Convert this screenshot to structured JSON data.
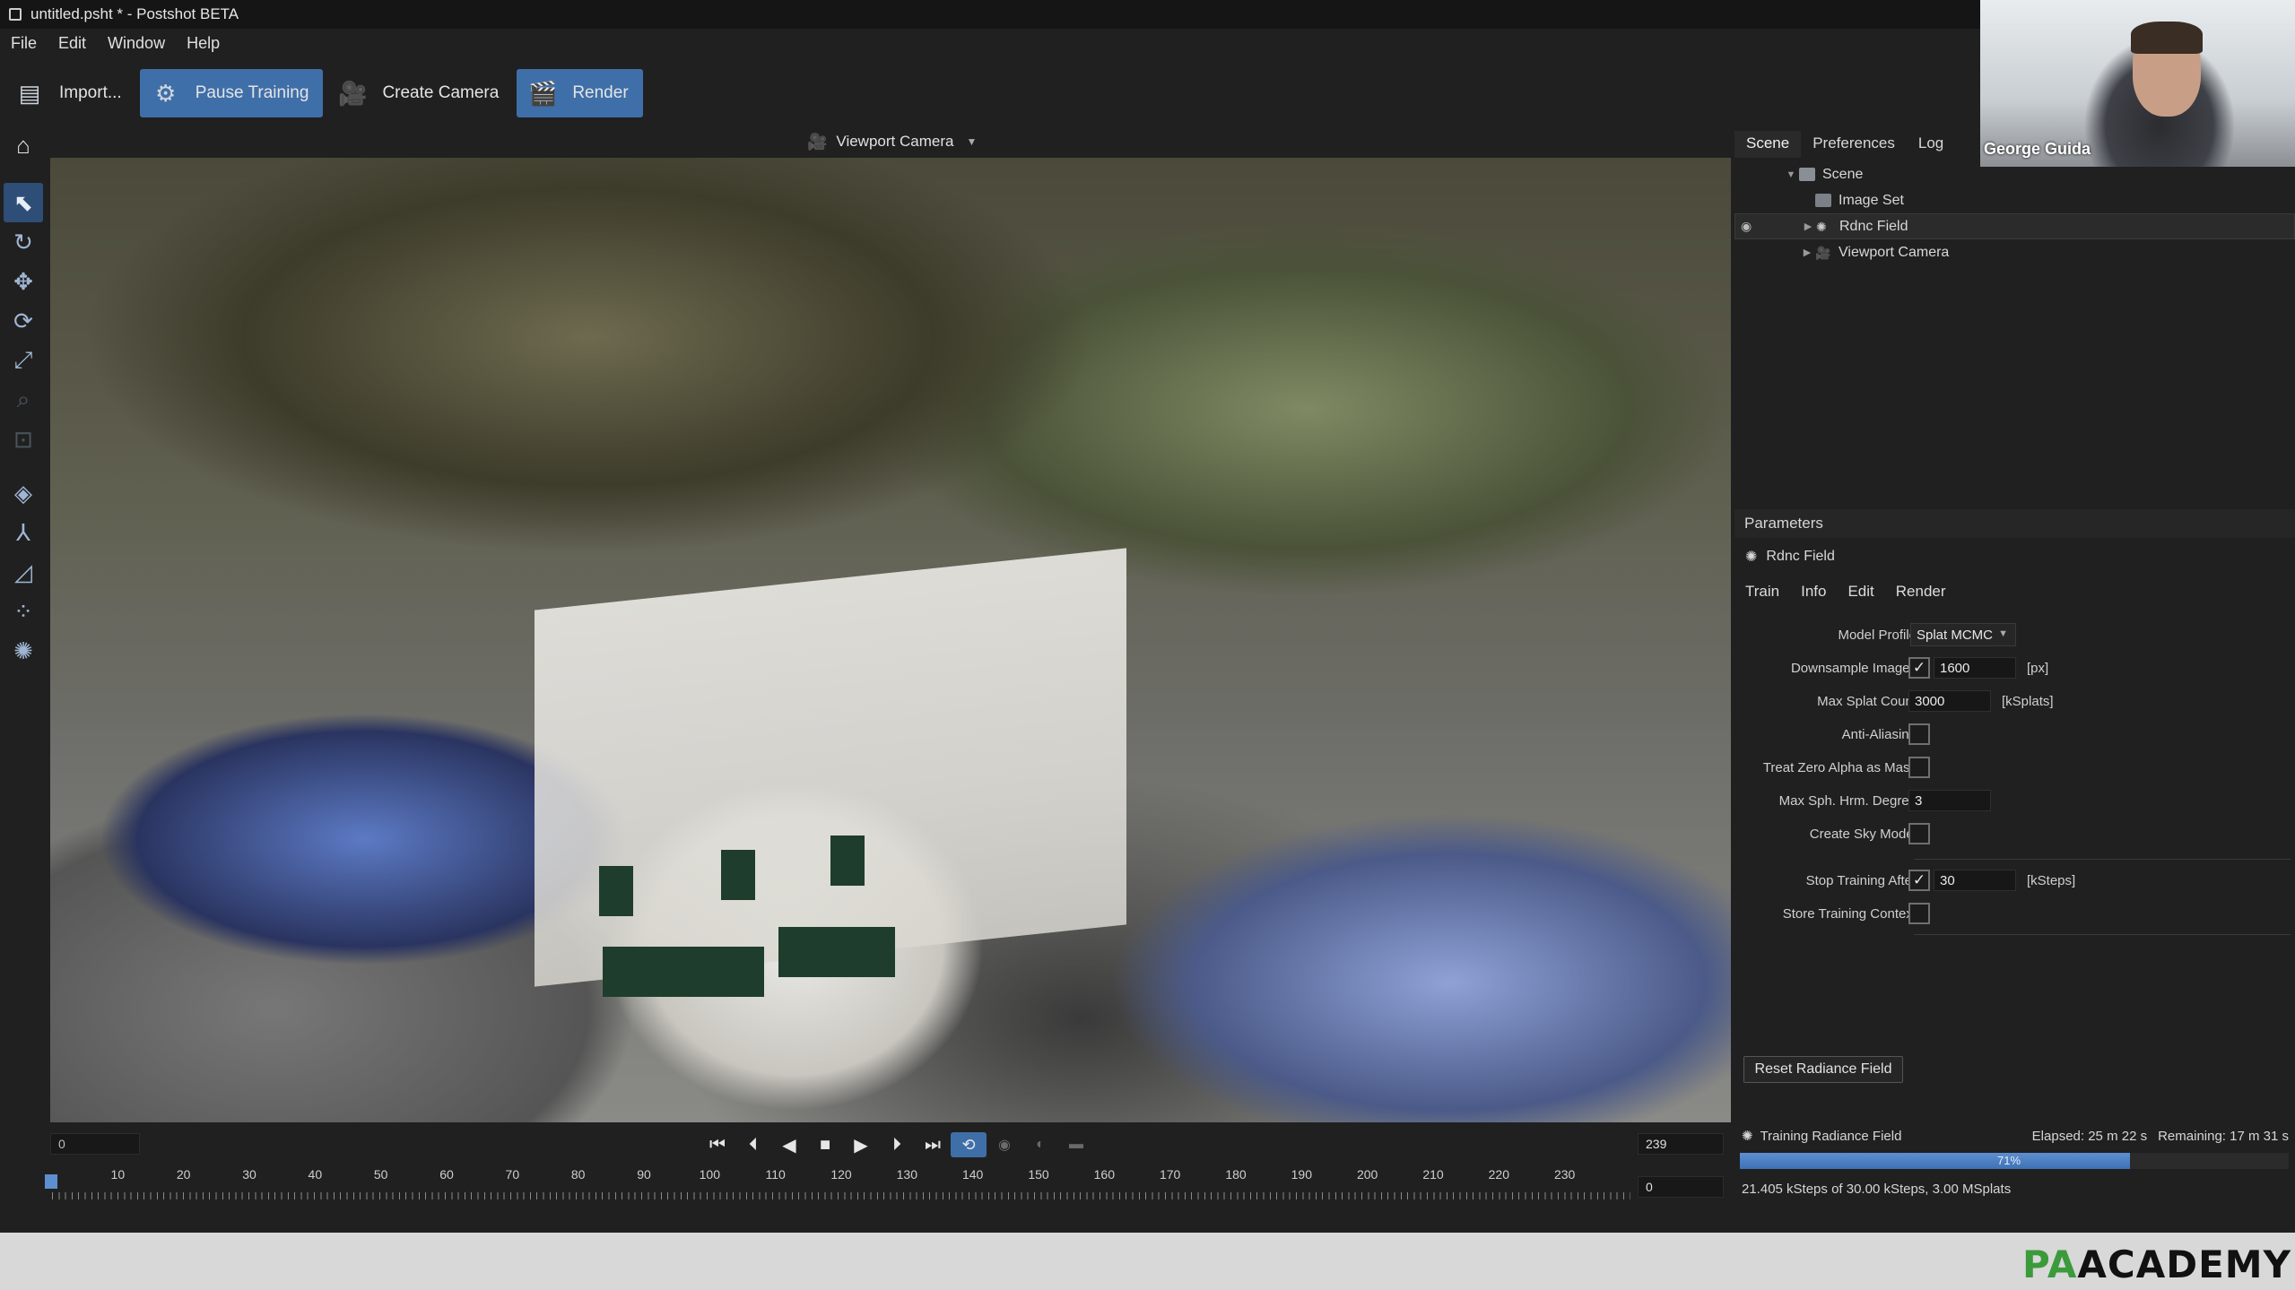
{
  "window": {
    "title": "untitled.psht * - Postshot BETA"
  },
  "menu": [
    "File",
    "Edit",
    "Window",
    "Help"
  ],
  "toolbar": {
    "import": "Import...",
    "pause_training": "Pause Training",
    "create_camera": "Create Camera",
    "render": "Render"
  },
  "viewport": {
    "camera_selector": "Viewport Camera"
  },
  "panel_tabs": [
    "Scene",
    "Preferences",
    "Log"
  ],
  "scene_tree": {
    "root": "Scene",
    "items": [
      "Image Set",
      "Rdnc Field",
      "Viewport Camera"
    ]
  },
  "parameters": {
    "header": "Parameters",
    "object": "Rdnc Field",
    "tabs": [
      "Train",
      "Info",
      "Edit",
      "Render"
    ],
    "model_profile_label": "Model Profile",
    "model_profile_value": "Splat MCMC",
    "downsample_label": "Downsample Images",
    "downsample_value": "1600",
    "downsample_unit": "[px]",
    "max_splat_label": "Max Splat Count",
    "max_splat_value": "3000",
    "max_splat_unit": "[kSplats]",
    "anti_alias_label": "Anti-Aliasing",
    "zero_alpha_label": "Treat Zero Alpha as Mask",
    "sph_label": "Max Sph. Hrm. Degree",
    "sph_value": "3",
    "sky_label": "Create Sky Model",
    "stop_label": "Stop Training After",
    "stop_value": "30",
    "stop_unit": "[kSteps]",
    "store_label": "Store Training Context",
    "reset_button": "Reset Radiance Field",
    "checks": {
      "downsample": true,
      "anti_alias": false,
      "zero_alpha": false,
      "sky": false,
      "stop": true,
      "store": false
    }
  },
  "status": {
    "task": "Training Radiance Field",
    "elapsed": "Elapsed: 25 m 22 s",
    "remaining": "Remaining: 17 m 31 s",
    "progress_label": "71%",
    "progress": 0.71,
    "detail": "21.405 kSteps of 30.00 kSteps, 3.00 MSplats"
  },
  "timeline": {
    "start_frame": "0",
    "end_frame": "239",
    "current_frame": "0",
    "ticks": [
      "0",
      "10",
      "20",
      "30",
      "40",
      "50",
      "60",
      "70",
      "80",
      "90",
      "100",
      "110",
      "120",
      "130",
      "140",
      "150",
      "160",
      "170",
      "180",
      "190",
      "200",
      "210",
      "220",
      "230"
    ]
  },
  "webcam": {
    "name": "George Guida"
  },
  "brand": {
    "pa": "PA",
    "rest": "ACADEMY"
  }
}
